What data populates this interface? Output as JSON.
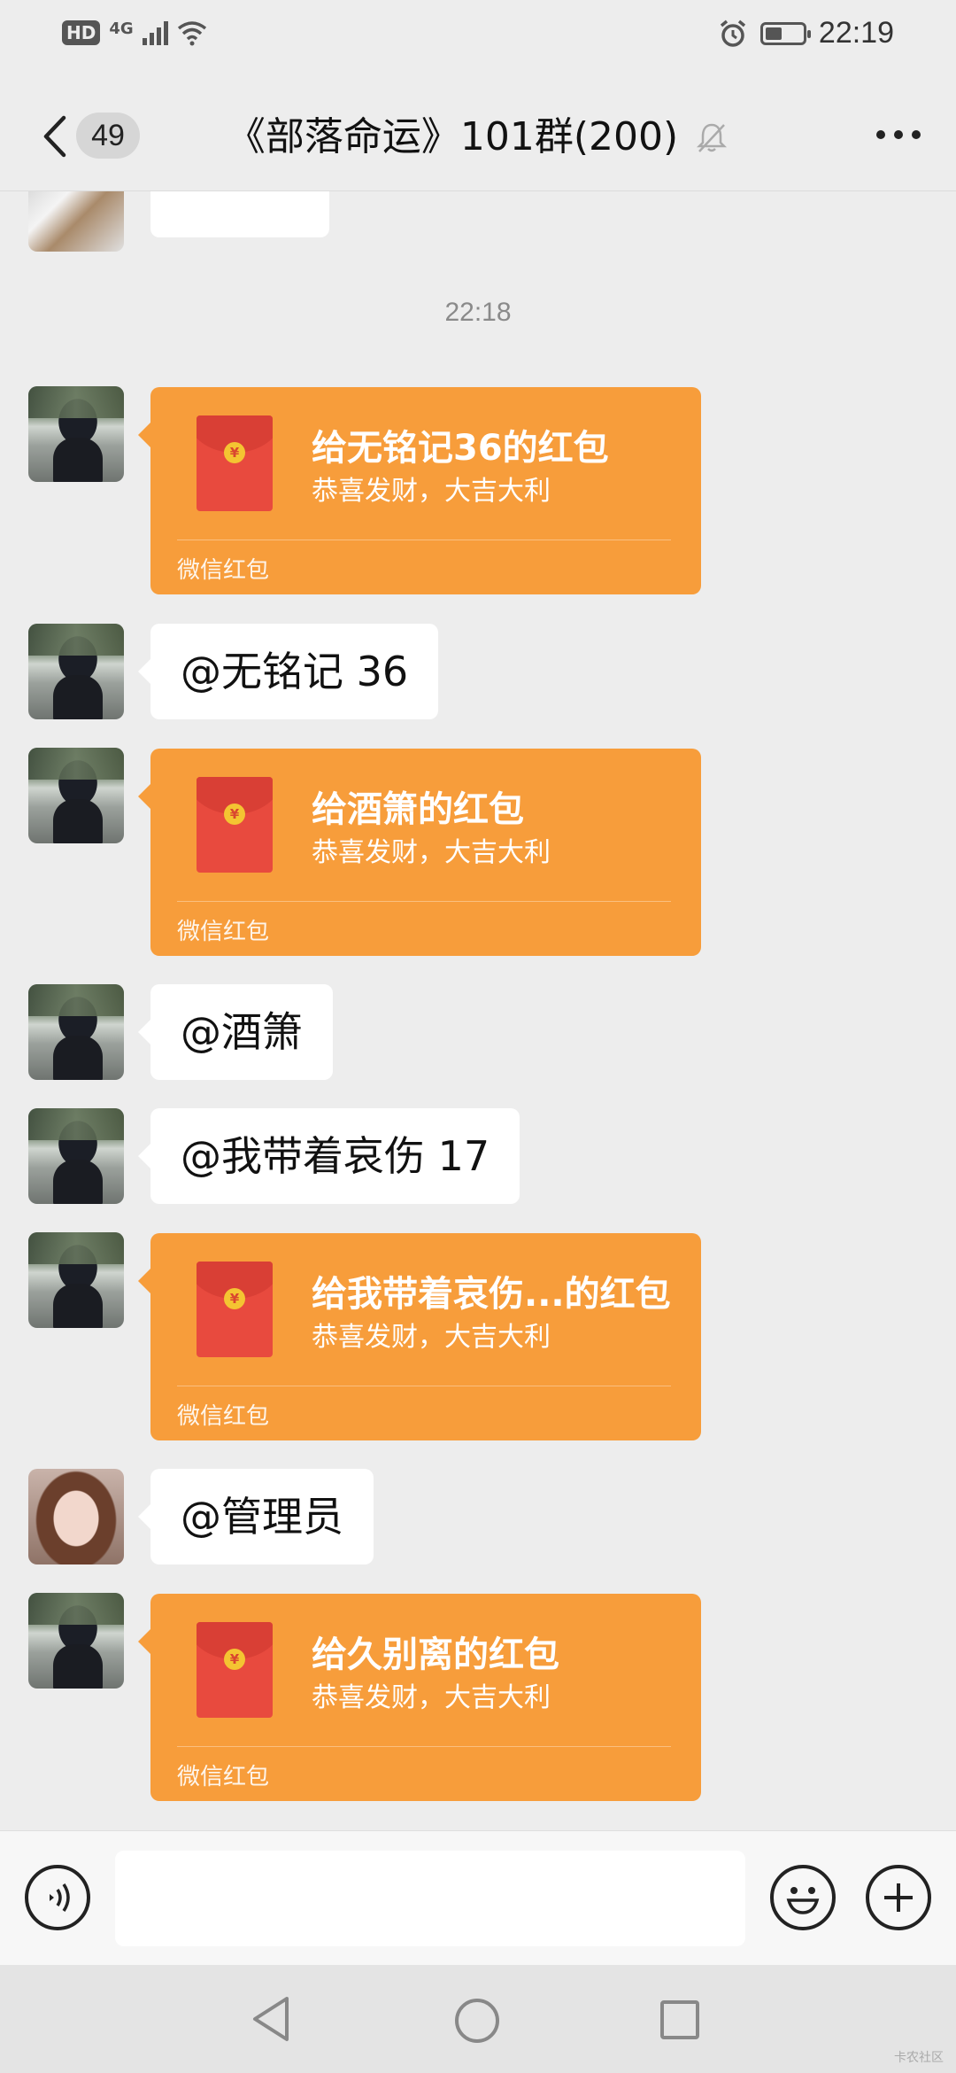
{
  "status_bar": {
    "hd": "HD",
    "network": "4G",
    "time": "22:19",
    "battery_level": 0.45
  },
  "header": {
    "unread_count": "49",
    "title": "《部落命运》101群(200)"
  },
  "chat": {
    "timestamp": "22:18",
    "red_packet_footer": "微信红包",
    "red_packet_wish": "恭喜发财，大吉大利",
    "red_packet_coin": "¥",
    "messages": [
      {
        "type": "red_packet",
        "title": "给无铭记36的红包"
      },
      {
        "type": "text",
        "text": "@无铭记 36"
      },
      {
        "type": "red_packet",
        "title": "给酒箫的红包"
      },
      {
        "type": "text",
        "text": "@酒箫"
      },
      {
        "type": "text",
        "text": "@我带着哀伤 17"
      },
      {
        "type": "red_packet",
        "title": "给我带着哀伤...的红包"
      },
      {
        "type": "text",
        "text": "@管理员"
      },
      {
        "type": "red_packet",
        "title": "给久别离的红包"
      }
    ]
  },
  "input": {
    "value": ""
  },
  "watermark": "卡农社区"
}
